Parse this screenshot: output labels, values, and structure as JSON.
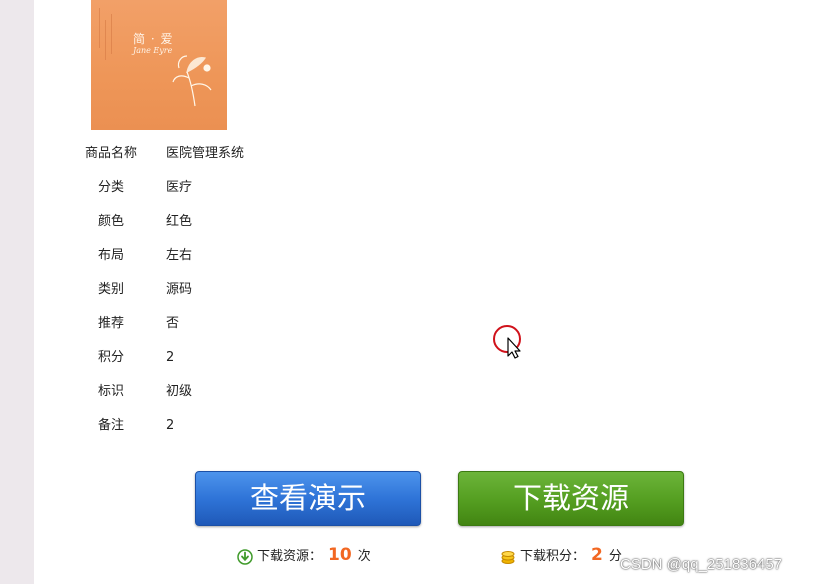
{
  "product_image": {
    "title": "简 · 爱",
    "subtitle": "Jane Eyre"
  },
  "attributes": [
    {
      "label": "商品名称",
      "value": "医院管理系统"
    },
    {
      "label": "分类",
      "value": "医疗"
    },
    {
      "label": "颜色",
      "value": "红色"
    },
    {
      "label": "布局",
      "value": "左右"
    },
    {
      "label": "类别",
      "value": "源码"
    },
    {
      "label": "推荐",
      "value": "否"
    },
    {
      "label": "积分",
      "value": "2"
    },
    {
      "label": "标识",
      "value": "初级"
    },
    {
      "label": "备注",
      "value": "2"
    }
  ],
  "buttons": {
    "demo_label": "查看演示",
    "download_label": "下载资源"
  },
  "stats": {
    "downloads_label": "下载资源：",
    "downloads_count": "10",
    "downloads_unit": "次",
    "points_label": "下载积分：",
    "points_count": "2",
    "points_unit": "分"
  },
  "watermark": "CSDN @qq_251836457",
  "colors": {
    "demo_button": "#2f74d8",
    "download_button": "#56a022",
    "count_highlight": "#f26722",
    "cover_orange": "#ee9658"
  },
  "icons": {
    "downloads": "download-arrow-icon",
    "points": "coin-stack-icon",
    "cursor": "mouse-pointer-icon"
  }
}
